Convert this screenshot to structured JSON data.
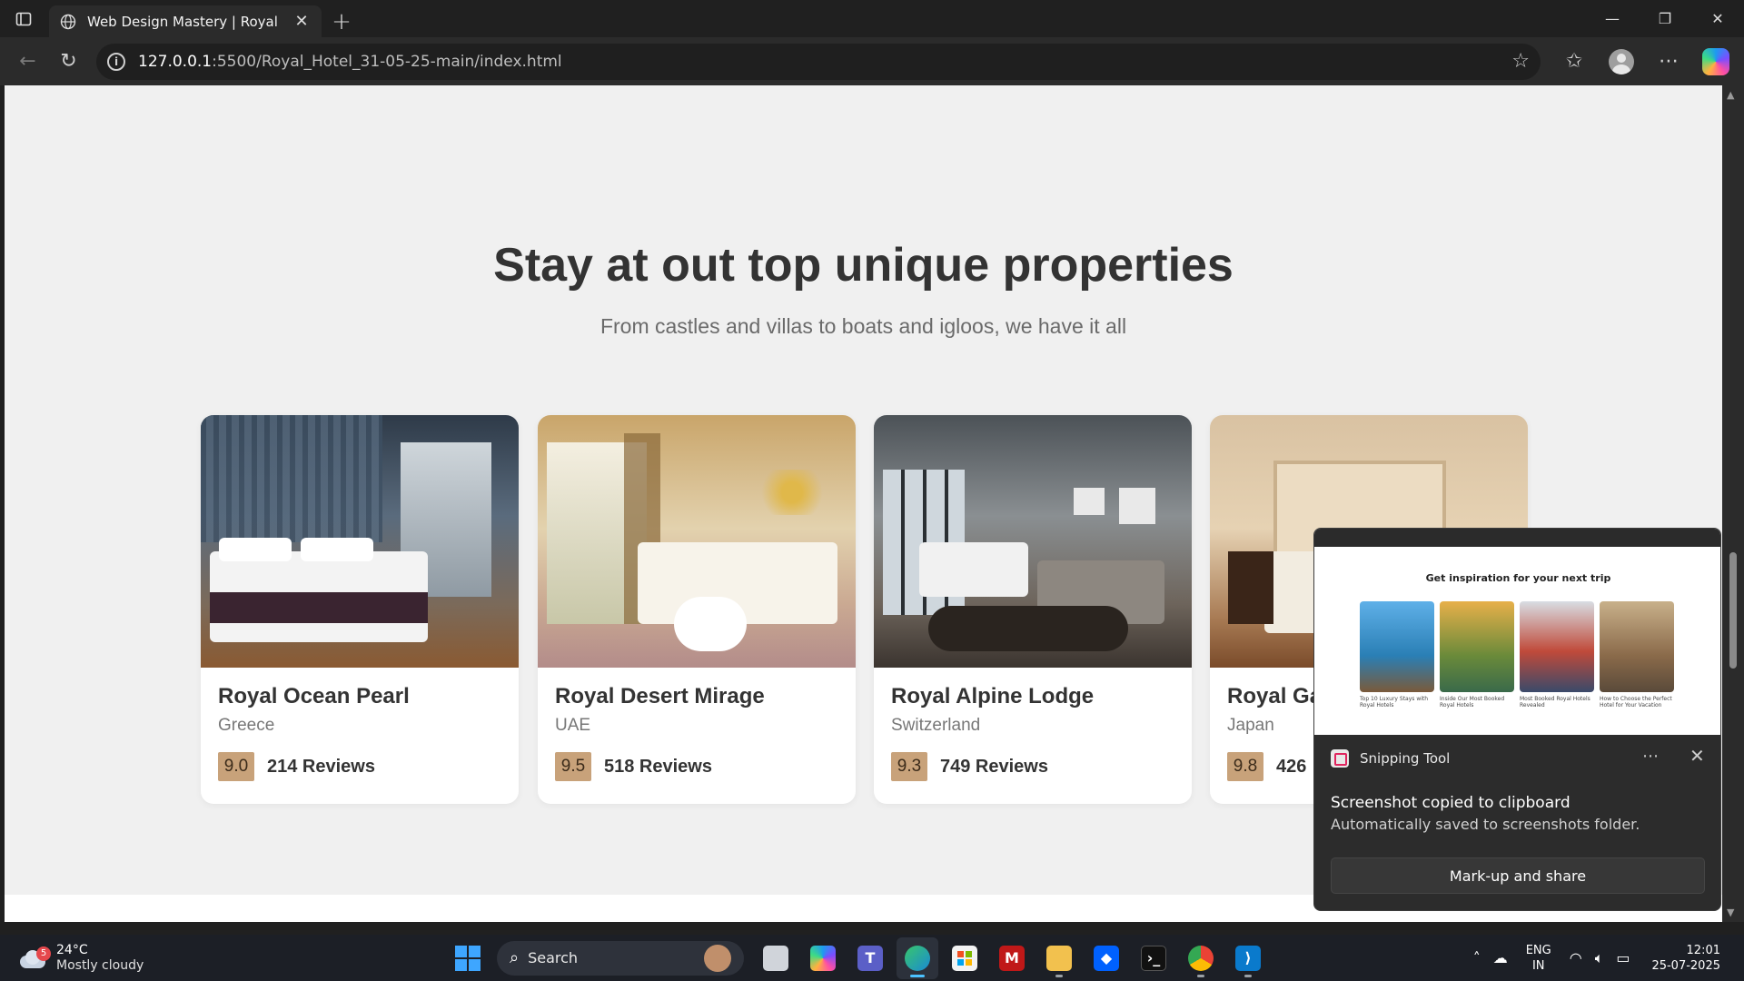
{
  "browser": {
    "tab_title": "Web Design Mastery | Royal Hotel",
    "url_host": "127.0.0.1",
    "url_path": ":5500/Royal_Hotel_31-05-25-main/index.html"
  },
  "page": {
    "heading": "Stay at out top unique properties",
    "subheading": "From castles and villas to boats and igloos, we have it all",
    "properties": [
      {
        "name": "Royal Ocean Pearl",
        "location": "Greece",
        "score": "9.0",
        "reviews": "214 Reviews"
      },
      {
        "name": "Royal Desert Mirage",
        "location": "UAE",
        "score": "9.5",
        "reviews": "518 Reviews"
      },
      {
        "name": "Royal Alpine Lodge",
        "location": "Switzerland",
        "score": "9.3",
        "reviews": "749 Reviews"
      },
      {
        "name": "Royal Ga",
        "location": "Japan",
        "score": "9.8",
        "reviews": "426"
      }
    ]
  },
  "toast": {
    "thumb_title": "Get inspiration for your next trip",
    "thumb_captions": [
      "Top 10 Luxury Stays with Royal Hotels",
      "Inside Our Most Booked Royal Hotels",
      "Most Booked Royal Hotels Revealed",
      "How to Choose the Perfect Hotel for Your Vacation"
    ],
    "app_name": "Snipping Tool",
    "headline": "Screenshot copied to clipboard",
    "body": "Automatically saved to screenshots folder.",
    "button": "Mark-up and share"
  },
  "taskbar": {
    "weather_badge": "5",
    "temperature": "24°C",
    "condition": "Mostly cloudy",
    "search_label": "Search",
    "lang_top": "ENG",
    "lang_bottom": "IN",
    "time": "12:01",
    "date": "25-07-2025"
  },
  "colors": {
    "score_badge": "#c8a27a",
    "page_bg": "#f0f0f0",
    "accent": "#4cc2ff"
  }
}
